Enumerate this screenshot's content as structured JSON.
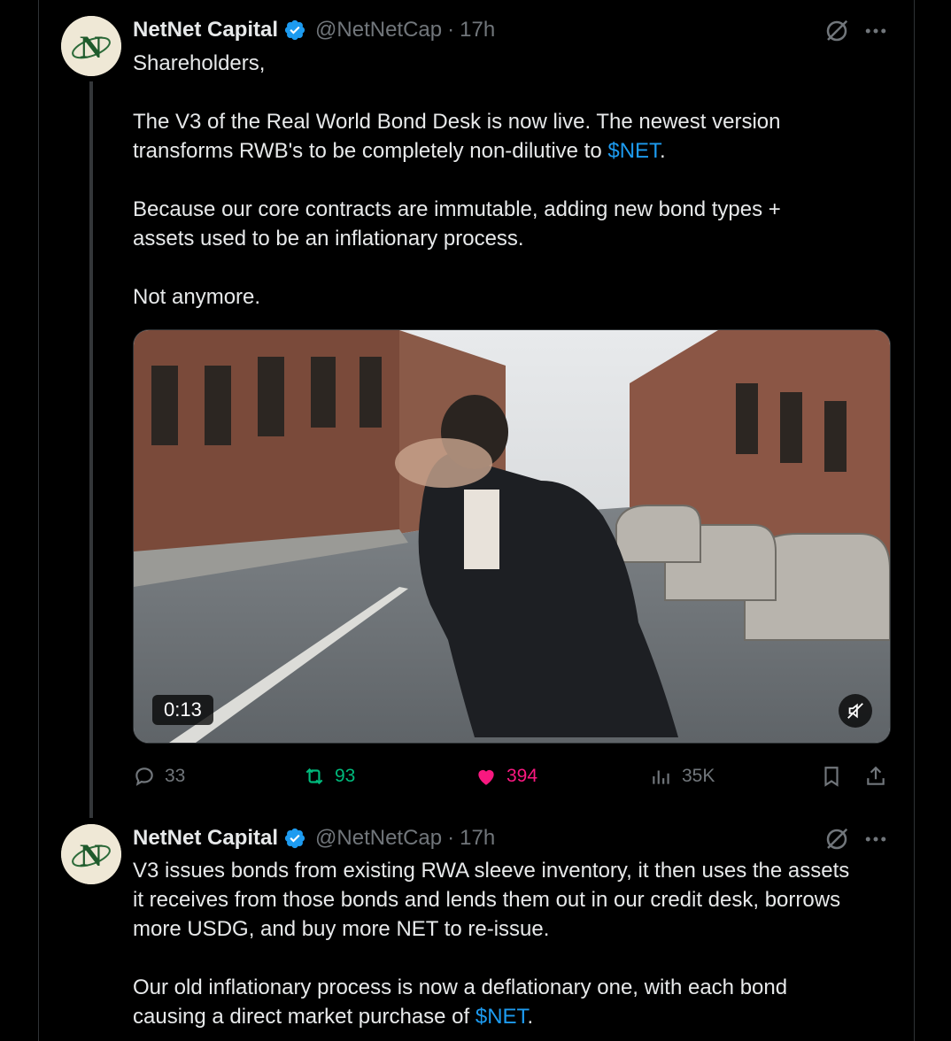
{
  "colors": {
    "background": "#000000",
    "text": "#e7e9ea",
    "muted": "#71767b",
    "link": "#1d9bf0",
    "retweet": "#00ba7c",
    "like": "#f91880",
    "verified": "#1d9bf0"
  },
  "tweets": [
    {
      "author": {
        "name": "NetNet Capital",
        "handle": "@NetNetCap",
        "time": "17h",
        "avatar_letter": "N",
        "verified": true
      },
      "paragraphs": [
        [
          "Shareholders,"
        ],
        [
          "The V3 of the Real World Bond Desk is now live. The newest version",
          "transforms RWB's to be completely non-dilutive to "
        ],
        [
          "Because our core contracts are immutable, adding new bond types +",
          "assets used to be an inflationary process."
        ],
        [
          "Not anymore."
        ]
      ],
      "cashtag": "$NET",
      "cashtag_suffix": ".",
      "media": {
        "type": "video",
        "duration": "0:13",
        "muted": true
      },
      "stats": {
        "replies": "33",
        "retweets": "93",
        "likes": "394",
        "liked": true,
        "views": "35K"
      },
      "icons": [
        "grok-icon",
        "more-icon",
        "reply-icon",
        "retweet-icon",
        "heart-icon",
        "views-icon",
        "bookmark-icon",
        "share-icon"
      ]
    },
    {
      "author": {
        "name": "NetNet Capital",
        "handle": "@NetNetCap",
        "time": "17h",
        "avatar_letter": "N",
        "verified": true
      },
      "paragraphs": [
        [
          "V3 issues bonds from existing RWA sleeve inventory, it then uses the assets",
          "it receives from those bonds and lends them out in our credit desk, borrows",
          "more USDG, and buy more NET to re-issue."
        ],
        [
          "Our old inflationary process is now a deflationary one, with each bond",
          "causing a direct market purchase of "
        ]
      ],
      "cashtag": "$NET",
      "cashtag_suffix": "."
    }
  ]
}
